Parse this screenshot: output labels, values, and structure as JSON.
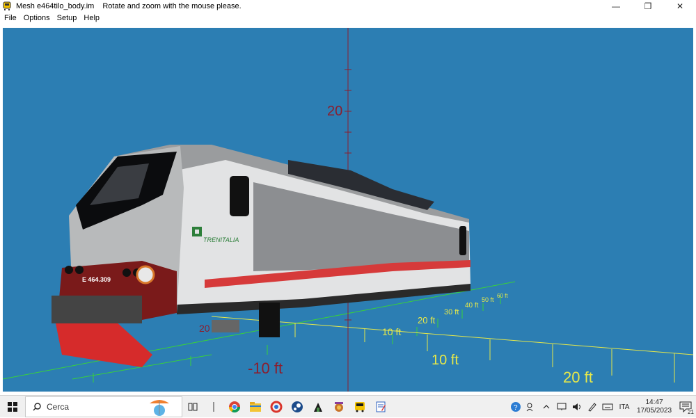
{
  "window": {
    "title": "Mesh e464tilo_body.im",
    "hint": "Rotate and zoom with the mouse please.",
    "controls": {
      "minimize": "—",
      "restore": "❐",
      "close": "✕"
    }
  },
  "menu": {
    "items": [
      "File",
      "Options",
      "Setup",
      "Help"
    ]
  },
  "scene": {
    "axis_labels": {
      "y20": "20",
      "red_m10": "-10 ft",
      "red_20": "20",
      "y10ft": "10 ft",
      "y20ft": "20 ft",
      "g10": "10 ft",
      "g20": "20 ft",
      "g30": "30 ft",
      "g40": "40 ft",
      "g50": "50 ft",
      "g60": "60 ft"
    },
    "locomotive": {
      "number": "E 464.309",
      "brand": "TRENITALIA"
    },
    "colors": {
      "background": "#2c7eb3",
      "grid_green": "#39d13a",
      "grid_yellow": "#e6e84a",
      "axis_red": "#8b1e2e"
    }
  },
  "taskbar": {
    "search_placeholder": "Cerca",
    "language": "ITA",
    "time": "14:47",
    "date": "17/05/2023",
    "notification_count": "21",
    "apps": [
      "task-view-icon",
      "chrome-icon",
      "file-explorer-icon",
      "ccleaner-icon",
      "steam-icon",
      "app-icon",
      "game-icon",
      "bus-icon",
      "notepad-icon"
    ]
  }
}
